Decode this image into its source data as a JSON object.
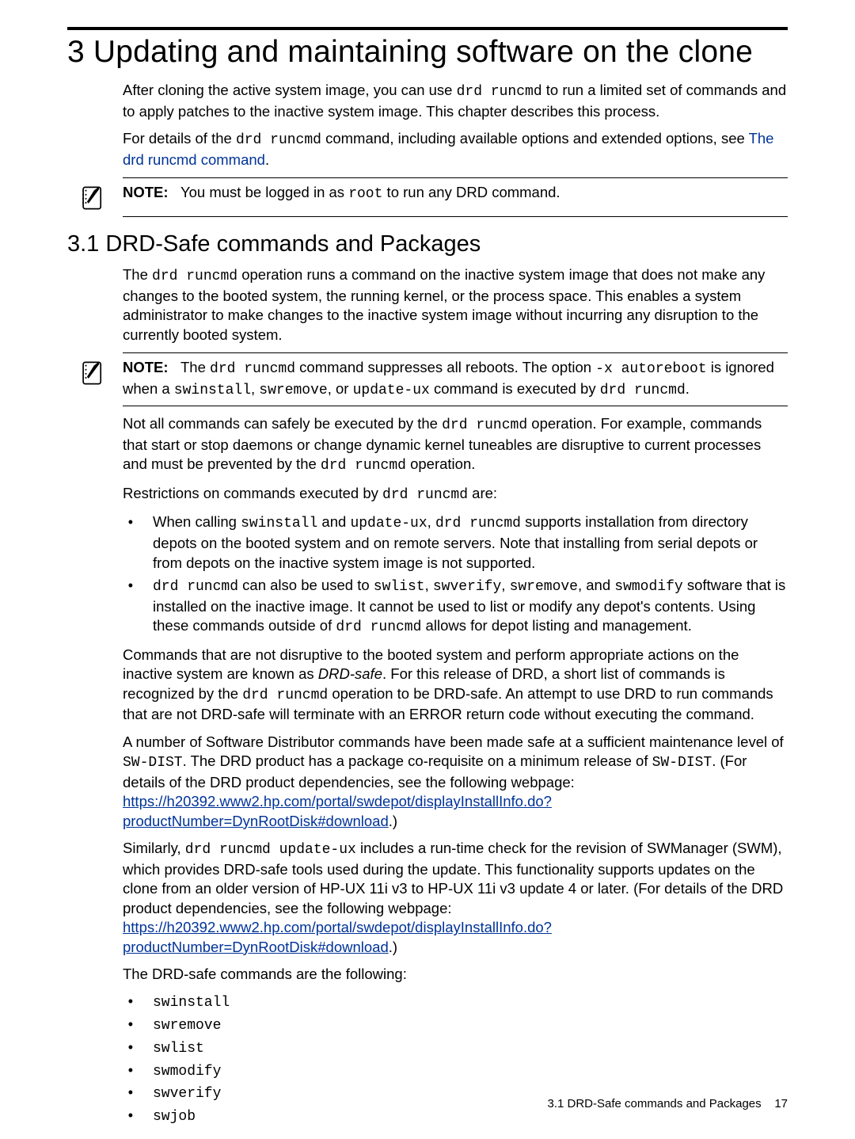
{
  "chapter": {
    "title": "3 Updating and maintaining software on the clone"
  },
  "intro": {
    "p1a": "After cloning the active system image, you can use ",
    "p1cmd": "drd runcmd",
    "p1b": " to run a limited set of commands and to apply patches to the inactive system image. This chapter describes this process.",
    "p2a": "For details of the ",
    "p2cmd": "drd runcmd",
    "p2b": " command, including available options and extended options, see ",
    "p2link": "The drd runcmd command",
    "p2c": "."
  },
  "note1": {
    "label": "NOTE:",
    "a": "You must be logged in as ",
    "cmd": "root",
    "b": " to run any DRD command."
  },
  "section31": {
    "heading": "3.1 DRD-Safe commands and Packages",
    "p1a": "The ",
    "p1cmd": "drd runcmd",
    "p1b": " operation runs a command on the inactive system image that does not make any changes to the booted system, the running kernel, or the process space. This enables a system administrator to make changes to the inactive system image without incurring any disruption to the currently booted system."
  },
  "note2": {
    "label": "NOTE:",
    "a": "The ",
    "cmd1": "drd runcmd",
    "b": " command suppresses all reboots. The option ",
    "cmd2": "-x autoreboot",
    "c": " is ignored when a ",
    "cmd3": "swinstall",
    "d": ", ",
    "cmd4": "swremove",
    "e": ", or ",
    "cmd5": "update-ux",
    "f": " command is executed by ",
    "cmd6": "drd runcmd",
    "g": "."
  },
  "body": {
    "p3a": "Not all commands can safely be executed by the ",
    "p3cmd1": "drd runcmd",
    "p3b": " operation. For example, commands that start or stop daemons or change dynamic kernel tuneables are disruptive to current processes and must be prevented by the ",
    "p3cmd2": "drd runcmd",
    "p3c": " operation.",
    "p4a": "Restrictions on commands executed by ",
    "p4cmd": "drd runcmd",
    "p4b": " are:",
    "b1": {
      "a": "When calling ",
      "cmd1": "swinstall",
      "b": " and ",
      "cmd2": "update-ux",
      "c": ", ",
      "cmd3": "drd runcmd",
      "d": " supports installation from directory depots on the booted system and on remote servers. Note that installing from serial depots or from depots on the inactive system image is not supported."
    },
    "b2": {
      "cmd1": "drd runcmd",
      "a": " can also be used to ",
      "cmd2": "swlist",
      "b": ", ",
      "cmd3": "swverify",
      "c": ", ",
      "cmd4": "swremove",
      "d": ", and ",
      "cmd5": "swmodify",
      "e": " software that is installed on the inactive image. It cannot be used to list or modify any depot's contents. Using these commands outside of ",
      "cmd6": "drd runcmd",
      "f": " allows for depot listing and management."
    },
    "p5a": "Commands that are not disruptive to the booted system and perform appropriate actions on the inactive system are known as ",
    "p5em": "DRD-safe",
    "p5b": ". For this release of DRD, a short list of commands is recognized by the ",
    "p5cmd": "drd runcmd",
    "p5c": " operation to be DRD-safe. An attempt to use DRD to run commands that are not DRD-safe will terminate with an ERROR return code without executing the command.",
    "p6a": "A number of Software Distributor commands have been made safe at a sufficient maintenance level of ",
    "p6cmd1": "SW-DIST",
    "p6b": ". The DRD product has a package co-requisite on a minimum release of ",
    "p6cmd2": "SW-DIST",
    "p6c": ". (For details of the DRD product dependencies, see the following webpage: ",
    "p6link": "https://h20392.www2.hp.com/portal/swdepot/displayInstallInfo.do?productNumber=DynRootDisk#download",
    "p6d": ".)",
    "p7a": "Similarly, ",
    "p7cmd": "drd runcmd update-ux",
    "p7b": " includes a run-time check for the revision of SWManager (SWM), which provides DRD-safe tools used during the update. This functionality supports updates on the clone from an older version of HP-UX 11i v3 to HP-UX 11i v3 update 4 or later. (For details of the DRD product dependencies, see the following webpage: ",
    "p7link": "https://h20392.www2.hp.com/portal/swdepot/displayInstallInfo.do?productNumber=DynRootDisk#download",
    "p7c": ".)",
    "p8": "The DRD-safe commands are the following:",
    "cmds": {
      "c1": "swinstall",
      "c2": "swremove",
      "c3": "swlist",
      "c4": "swmodify",
      "c5": "swverify",
      "c6": "swjob"
    }
  },
  "footer": {
    "text": "3.1 DRD-Safe commands and Packages",
    "page": "17"
  }
}
